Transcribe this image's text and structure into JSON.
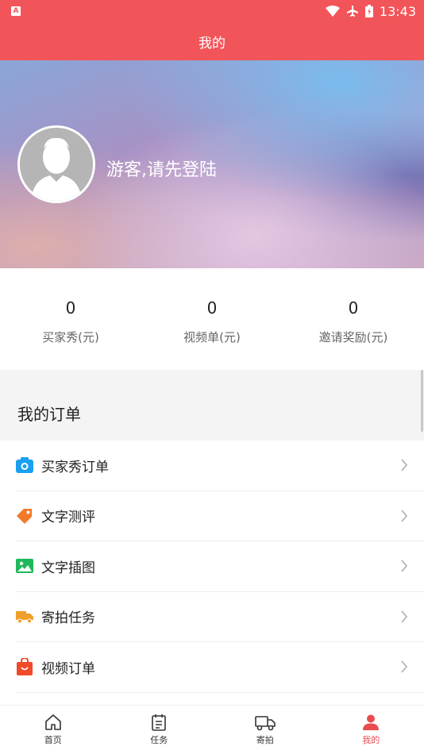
{
  "status_bar": {
    "time": "13:43",
    "left_badge": "A"
  },
  "header": {
    "title": "我的"
  },
  "profile": {
    "login_prompt": "游客,请先登陆"
  },
  "stats": [
    {
      "value": "0",
      "label": "买家秀(元)"
    },
    {
      "value": "0",
      "label": "视频单(元)"
    },
    {
      "value": "0",
      "label": "邀请奖励(元)"
    }
  ],
  "orders": {
    "section_title": "我的订单",
    "items": [
      {
        "label": "买家秀订单",
        "icon": "camera-icon",
        "color": "#1aa0f0"
      },
      {
        "label": "文字测评",
        "icon": "tag-icon",
        "color": "#f07a2a"
      },
      {
        "label": "文字插图",
        "icon": "image-icon",
        "color": "#1fb85b"
      },
      {
        "label": "寄拍任务",
        "icon": "truck-icon",
        "color": "#f0a02a"
      },
      {
        "label": "视频订单",
        "icon": "shopping-bag-icon",
        "color": "#f04a2a"
      }
    ]
  },
  "tabbar": {
    "active_color": "#e84c4f",
    "tabs": [
      {
        "label": "首页",
        "icon": "home-icon"
      },
      {
        "label": "任务",
        "icon": "clipboard-icon"
      },
      {
        "label": "寄拍",
        "icon": "truck-icon"
      },
      {
        "label": "我的",
        "icon": "person-icon"
      }
    ]
  }
}
